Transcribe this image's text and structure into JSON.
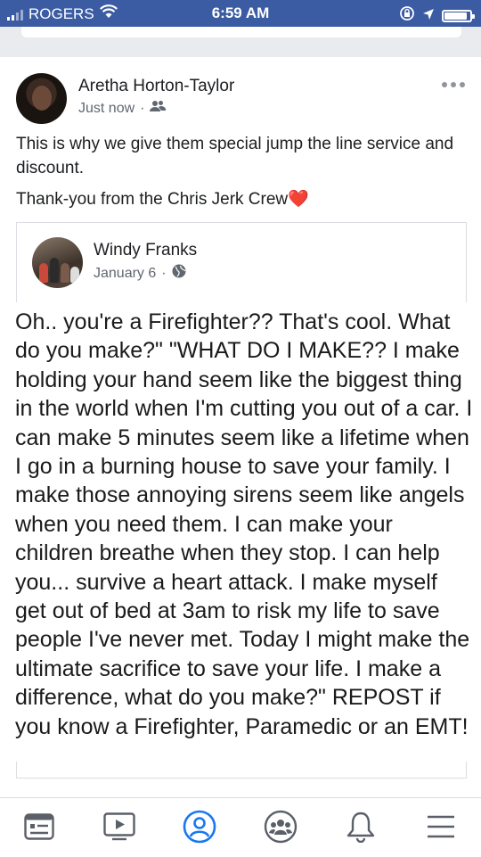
{
  "status_bar": {
    "carrier": "ROGERS",
    "time": "6:59 AM",
    "battery_level": 0.9,
    "icons": [
      "signal-icon",
      "wifi-icon",
      "rotation-lock-icon",
      "location-icon",
      "battery-icon"
    ]
  },
  "post": {
    "author": "Aretha Horton-Taylor",
    "timestamp": "Just now",
    "separator": "·",
    "audience_icon": "friends-icon",
    "caption_line1": "This is why we give them special jump the line service and discount.",
    "caption_line2": "Thank-you from the Chris Jerk Crew",
    "heart": "❤️",
    "shared": {
      "author": "Windy Franks",
      "date": "January 6",
      "separator": "·",
      "audience_icon": "globe-icon",
      "image_text": "Oh.. you're a Firefighter?? That's cool. What do you make?\" \"WHAT DO I MAKE?? I make holding your hand seem like the biggest thing in the world when I'm cutting you out of a car. I can make 5 minutes seem like a lifetime when I go in a burning house to save your family. I make those annoying sirens seem like angels when you need them. I can make your children breathe when they stop. I can help you... survive a heart attack. I make myself get out of bed at 3am to risk my life to save people I've never met. Today I might make the ultimate sacrifice to save your life. I make a difference, what do you make?\" REPOST if you know a Firefighter, Paramedic or an EMT!"
    }
  },
  "tab_bar": {
    "tabs": [
      "news-feed-icon",
      "watch-icon",
      "profile-icon",
      "groups-icon",
      "notifications-icon",
      "menu-icon"
    ],
    "active_color": "#1877f2",
    "inactive_color": "#5b6068"
  },
  "colors": {
    "status_bar": "#3b5ba3",
    "divider": "#e9ebee",
    "secondary_text": "#616770"
  }
}
